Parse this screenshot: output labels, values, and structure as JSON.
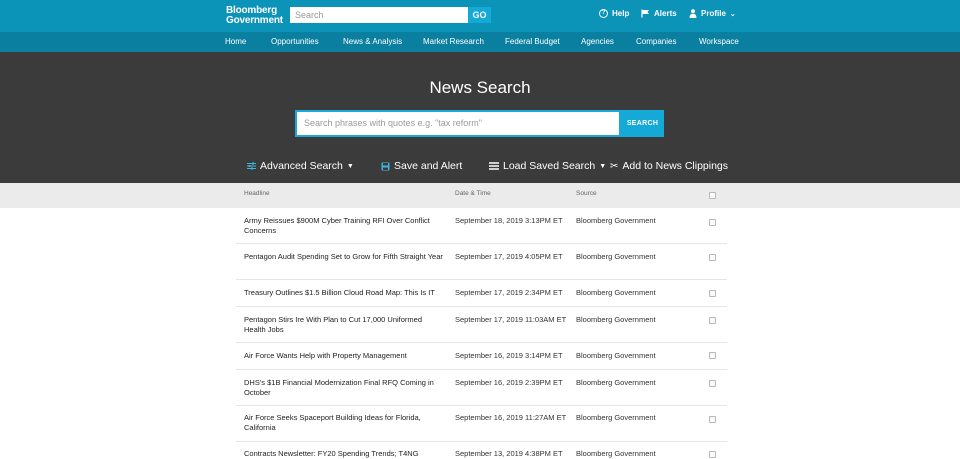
{
  "topbar": {
    "logo_line1": "Bloomberg",
    "logo_line2": "Government",
    "search_placeholder": "Search",
    "go_label": "GO",
    "help_label": "Help",
    "alerts_label": "Alerts",
    "profile_label": "Profile"
  },
  "nav": {
    "items": [
      "Home",
      "Opportunities",
      "News & Analysis",
      "Market Research",
      "Federal Budget",
      "Agencies",
      "Companies",
      "Workspace"
    ]
  },
  "hero": {
    "title": "News Search",
    "search_placeholder": "Search phrases with quotes e.g. \"tax reform\"",
    "search_button": "SEARCH",
    "advanced_search": "Advanced Search",
    "save_and_alert": "Save and Alert",
    "load_saved_search": "Load Saved Search",
    "add_to_clippings": "Add to News Clippings"
  },
  "table": {
    "headers": {
      "headline": "Headline",
      "date": "Date & Time",
      "source": "Source"
    },
    "rows": [
      {
        "headline": "Army Reissues $900M Cyber Training RFI Over Conflict Concerns",
        "date": "September 18, 2019 3:13PM ET",
        "source": "Bloomberg Government"
      },
      {
        "headline": "Pentagon Audit Spending Set to Grow for Fifth Straight Year",
        "date": "September 17, 2019 4:05PM ET",
        "source": "Bloomberg Government"
      },
      {
        "headline": "Treasury Outlines $1.5 Billion Cloud Road Map: This Is IT",
        "date": "September 17, 2019 2:34PM ET",
        "source": "Bloomberg Government"
      },
      {
        "headline": "Pentagon Stirs Ire With Plan to Cut 17,000 Uniformed Health Jobs",
        "date": "September 17, 2019 11:03AM ET",
        "source": "Bloomberg Government"
      },
      {
        "headline": "Air Force Wants Help with Property Management",
        "date": "September 16, 2019 3:14PM ET",
        "source": "Bloomberg Government"
      },
      {
        "headline": "DHS's $1B Financial Modernization Final RFQ Coming in October",
        "date": "September 16, 2019 2:39PM ET",
        "source": "Bloomberg Government"
      },
      {
        "headline": "Air Force Seeks Spaceport Building Ideas for Florida, California",
        "date": "September 16, 2019 11:27AM ET",
        "source": "Bloomberg Government"
      },
      {
        "headline": "Contracts Newsletter: FY20 Spending Trends; T4NG",
        "date": "September 13, 2019 4:38PM ET",
        "source": "Bloomberg Government"
      }
    ]
  },
  "colors": {
    "topbar": "#0c93b8",
    "navbar": "#0a7fa0",
    "hero": "#3b3b3b",
    "accent": "#14a9d6"
  }
}
